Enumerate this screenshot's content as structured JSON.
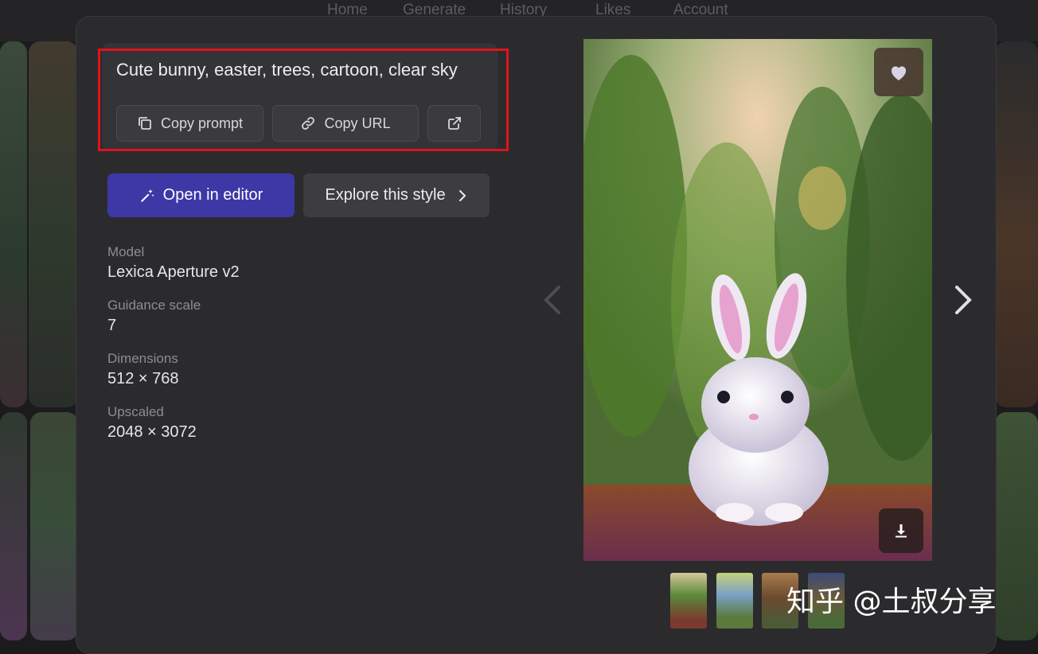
{
  "nav": {
    "items": [
      "Home",
      "Generate",
      "History",
      "Likes",
      "Account"
    ]
  },
  "prompt": {
    "text": "Cute bunny, easter, trees, cartoon, clear sky",
    "copy_prompt_label": "Copy prompt",
    "copy_url_label": "Copy URL"
  },
  "actions": {
    "open_editor_label": "Open in editor",
    "explore_style_label": "Explore this style"
  },
  "details": [
    {
      "label": "Model",
      "value": "Lexica Aperture v2"
    },
    {
      "label": "Guidance scale",
      "value": "7"
    },
    {
      "label": "Dimensions",
      "value": "512 × 768"
    },
    {
      "label": "Upscaled",
      "value": "2048 × 3072"
    }
  ],
  "image": {
    "like_icon": "heart-icon",
    "download_icon": "download-icon",
    "prev_icon": "chevron-left-icon",
    "next_icon": "chevron-right-icon"
  },
  "thumbnails_count_visible": 4,
  "watermark": "知乎 @土叔分享",
  "colors": {
    "primary_button": "#3d38a6",
    "highlight_border": "#e0131a",
    "modal_bg": "#2b2b2e"
  }
}
